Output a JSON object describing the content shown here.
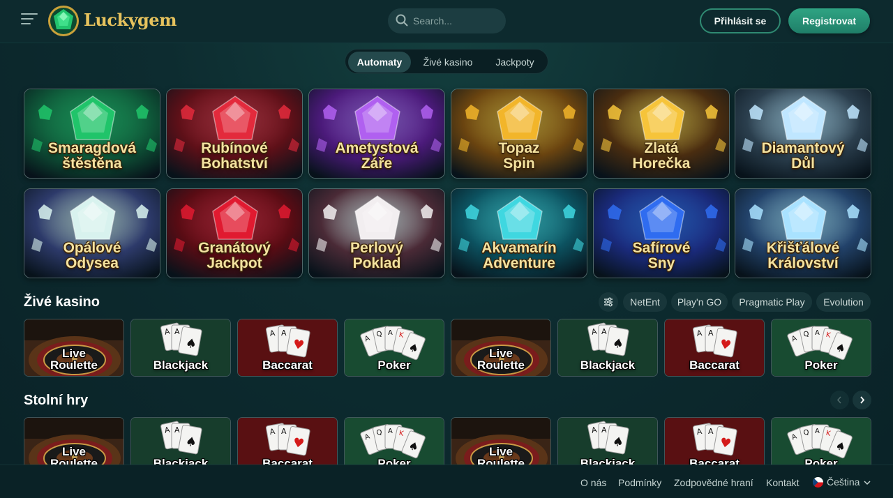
{
  "header": {
    "logo_text": "Luckygem",
    "search_placeholder": "Search...",
    "login_label": "Přihlásit se",
    "register_label": "Registrovat"
  },
  "tabs": [
    {
      "label": "Automaty",
      "active": true
    },
    {
      "label": "Živé kasino",
      "active": false
    },
    {
      "label": "Jackpoty",
      "active": false
    }
  ],
  "slots": [
    {
      "line1": "Smaragdová",
      "line2": "štěstěna",
      "bg": "#0f5a3a",
      "gem": "#20c46a"
    },
    {
      "line1": "Rubínové",
      "line2": "Bohatství",
      "bg": "#5e1018",
      "gem": "#e32a3c"
    },
    {
      "line1": "Ametystová",
      "line2": "Záře",
      "bg": "#4b1a7a",
      "gem": "#b060f0"
    },
    {
      "line1": "Topaz",
      "line2": "Spin",
      "bg": "#6a4410",
      "gem": "#f2b52a"
    },
    {
      "line1": "Zlatá",
      "line2": "Horečka",
      "bg": "#4a2d10",
      "gem": "#f6c43a"
    },
    {
      "line1": "Diamantový",
      "line2": "Důl",
      "bg": "#2b3f4e",
      "gem": "#bfe6ff"
    },
    {
      "line1": "Opálové",
      "line2": "Odysea",
      "bg": "#2d3a6a",
      "gem": "#d8f2ee"
    },
    {
      "line1": "Granátový",
      "line2": "Jackpot",
      "bg": "#5a0c14",
      "gem": "#e01a30"
    },
    {
      "line1": "Perlový",
      "line2": "Poklad",
      "bg": "#4a2a36",
      "gem": "#f2eef0"
    },
    {
      "line1": "Akvamarín",
      "line2": "Adventure",
      "bg": "#0c5260",
      "gem": "#3fd7e0"
    },
    {
      "line1": "Safírové",
      "line2": "Sny",
      "bg": "#1a2a7a",
      "gem": "#2f6cf0"
    },
    {
      "line1": "Křišťálové",
      "line2": "Království",
      "bg": "#22426a",
      "gem": "#a9e2ff"
    }
  ],
  "live_section": {
    "title": "Živé kasino",
    "providers": [
      "NetEnt",
      "Play'n GO",
      "Pragmatic Play",
      "Evolution"
    ]
  },
  "table_section": {
    "title": "Stolní hry"
  },
  "live_games": [
    {
      "line1": "Live",
      "line2": "Roulette",
      "kind": "roulette"
    },
    {
      "line1": "",
      "line2": "Blackjack",
      "kind": "blackjack"
    },
    {
      "line1": "",
      "line2": "Baccarat",
      "kind": "baccarat"
    },
    {
      "line1": "",
      "line2": "Poker",
      "kind": "poker"
    },
    {
      "line1": "Live",
      "line2": "Roulette",
      "kind": "roulette"
    },
    {
      "line1": "",
      "line2": "Blackjack",
      "kind": "blackjack"
    },
    {
      "line1": "",
      "line2": "Baccarat",
      "kind": "baccarat"
    },
    {
      "line1": "",
      "line2": "Poker",
      "kind": "poker"
    }
  ],
  "table_games": [
    {
      "line1": "Live",
      "line2": "Roulette",
      "kind": "roulette"
    },
    {
      "line1": "",
      "line2": "Blackjack",
      "kind": "blackjack"
    },
    {
      "line1": "",
      "line2": "Baccarat",
      "kind": "baccarat"
    },
    {
      "line1": "",
      "line2": "Poker",
      "kind": "poker"
    },
    {
      "line1": "Live",
      "line2": "Roulette",
      "kind": "roulette"
    },
    {
      "line1": "",
      "line2": "Blackjack",
      "kind": "blackjack"
    },
    {
      "line1": "",
      "line2": "Baccarat",
      "kind": "baccarat"
    },
    {
      "line1": "",
      "line2": "Poker",
      "kind": "poker"
    }
  ],
  "footer": {
    "links": [
      "O nás",
      "Podmínky",
      "Zodpovědné hraní",
      "Kontakt"
    ],
    "language": "Čeština"
  }
}
